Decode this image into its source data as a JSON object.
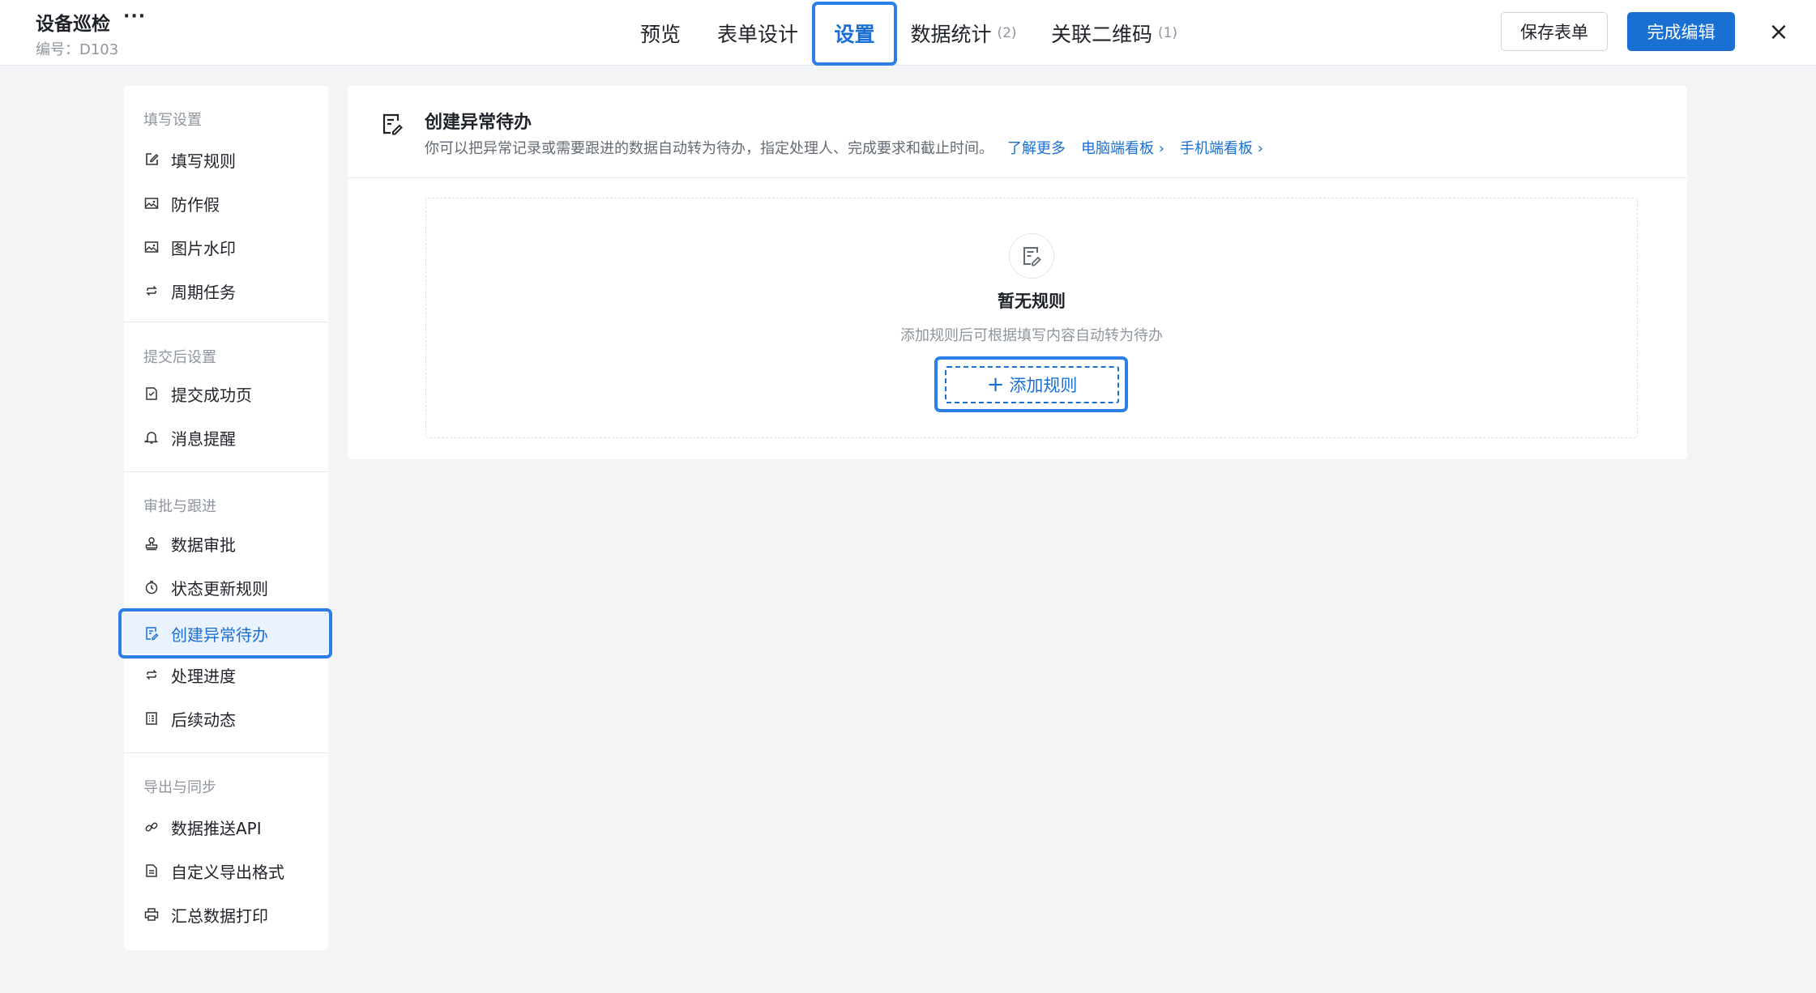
{
  "header": {
    "title": "设备巡检",
    "more_icon": "···",
    "code": "编号：D103",
    "tabs": [
      {
        "label": "预览",
        "count": ""
      },
      {
        "label": "表单设计",
        "count": ""
      },
      {
        "label": "设置",
        "count": ""
      },
      {
        "label": "数据统计",
        "count": "(2)"
      },
      {
        "label": "关联二维码",
        "count": "(1)"
      }
    ],
    "active_tab": "设置",
    "save_label": "保存表单",
    "done_label": "完成编辑",
    "close_icon": "×"
  },
  "sidebar": {
    "sections": [
      {
        "title": "填写设置",
        "items": [
          {
            "label": "填写规则",
            "icon": "edit-icon"
          },
          {
            "label": "防作假",
            "icon": "image-icon"
          },
          {
            "label": "图片水印",
            "icon": "image-icon"
          },
          {
            "label": "周期任务",
            "icon": "cycle-icon"
          }
        ]
      },
      {
        "title": "提交后设置",
        "items": [
          {
            "label": "提交成功页",
            "icon": "doc-check-icon"
          },
          {
            "label": "消息提醒",
            "icon": "bell-icon"
          }
        ]
      },
      {
        "title": "审批与跟进",
        "items": [
          {
            "label": "数据审批",
            "icon": "stamp-icon"
          },
          {
            "label": "状态更新规则",
            "icon": "clock-icon"
          },
          {
            "label": "创建异常待办",
            "icon": "doc-edit-icon"
          },
          {
            "label": "处理进度",
            "icon": "cycle-icon"
          },
          {
            "label": "后续动态",
            "icon": "list-icon"
          }
        ]
      },
      {
        "title": "导出与同步",
        "items": [
          {
            "label": "数据推送API",
            "icon": "link-icon"
          },
          {
            "label": "自定义导出格式",
            "icon": "file-icon"
          },
          {
            "label": "汇总数据打印",
            "icon": "printer-icon"
          }
        ]
      }
    ],
    "active_item": "创建异常待办"
  },
  "panel": {
    "title": "创建异常待办",
    "description": "你可以把异常记录或需要跟进的数据自动转为待办，指定处理人、完成要求和截止时间。",
    "links": [
      "了解更多",
      "电脑端看板 ›",
      "手机端看板 ›"
    ],
    "empty_title": "暂无规则",
    "empty_subtitle": "添加规则后可根据填写内容自动转为待办",
    "add_button": "添加规则",
    "add_icon": "+"
  },
  "colors": {
    "accent": "#1a6fd3",
    "focus_ring": "#2d7fe8",
    "background": "#f3f4f6"
  }
}
